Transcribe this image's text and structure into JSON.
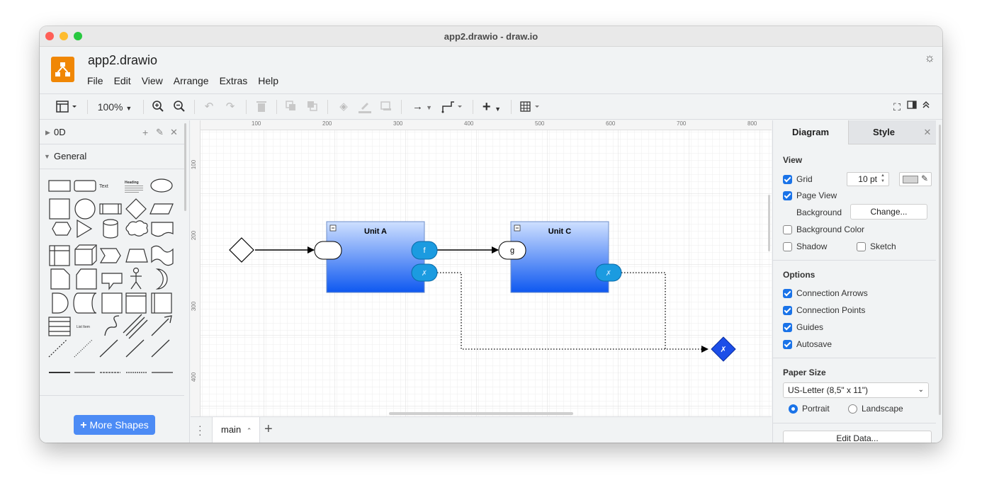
{
  "window": {
    "title": "app2.drawio - draw.io"
  },
  "header": {
    "doc_title": "app2.drawio",
    "menu": [
      "File",
      "Edit",
      "View",
      "Arrange",
      "Extras",
      "Help"
    ]
  },
  "toolbar": {
    "zoom": "100%"
  },
  "left_panel": {
    "sections": [
      {
        "label": "0D"
      },
      {
        "label": "General"
      }
    ],
    "shape_text_label": "Text",
    "shape_heading_label": "Heading",
    "shape_list_label": "List Item",
    "more_shapes": "More Shapes"
  },
  "canvas": {
    "ruler_x": [
      "100",
      "200",
      "300",
      "400",
      "500",
      "600",
      "700",
      "800"
    ],
    "ruler_y": [
      "100",
      "200",
      "300",
      "400"
    ],
    "unit_a": {
      "title": "Unit A",
      "port_out": "f",
      "port_x": "✗"
    },
    "unit_c": {
      "title": "Unit C",
      "port_in": "g",
      "port_x": "✗"
    },
    "end_diamond_label": "✗"
  },
  "page_tabs": {
    "current": "main"
  },
  "right_panel": {
    "tabs": [
      "Diagram",
      "Style"
    ],
    "view": {
      "heading": "View",
      "grid_label": "Grid",
      "grid_size": "10 pt",
      "page_view_label": "Page View",
      "background_label": "Background",
      "change_button": "Change...",
      "background_color_label": "Background Color",
      "shadow_label": "Shadow",
      "sketch_label": "Sketch"
    },
    "options": {
      "heading": "Options",
      "items": [
        "Connection Arrows",
        "Connection Points",
        "Guides",
        "Autosave"
      ]
    },
    "paper": {
      "heading": "Paper Size",
      "size": "US-Letter (8,5\" x 11\")",
      "portrait": "Portrait",
      "landscape": "Landscape"
    },
    "edit_data": "Edit Data..."
  },
  "colors": {
    "accent": "#1a73e8",
    "logo": "#f08705",
    "unit_top": "#c9dcff",
    "unit_bottom": "#0e58f0",
    "port": "#1b9be0"
  }
}
